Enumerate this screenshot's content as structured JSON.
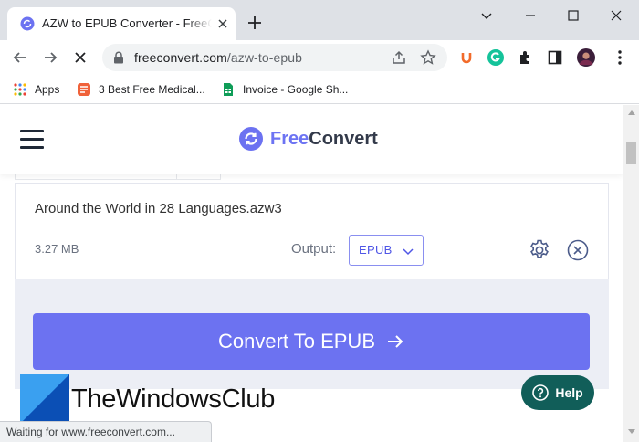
{
  "browser": {
    "tab_title": "AZW to EPUB Converter - FreeConvert",
    "url_domain": "freeconvert.com",
    "url_path": "/azw-to-epub",
    "bookmarks": [
      {
        "label": "Apps"
      },
      {
        "label": "3 Best Free Medical..."
      },
      {
        "label": "Invoice - Google Sh..."
      }
    ],
    "status": "Waiting for www.freeconvert.com..."
  },
  "site": {
    "logo_free": "Free",
    "logo_convert": "Convert",
    "brand_color": "#6c72f1"
  },
  "file": {
    "name": "Around the World in 28 Languages.azw3",
    "size": "3.27 MB",
    "output_label": "Output:",
    "output_format": "EPUB"
  },
  "convert_button": "Convert To EPUB",
  "help_button": "Help",
  "watermark": "TheWindowsClub"
}
